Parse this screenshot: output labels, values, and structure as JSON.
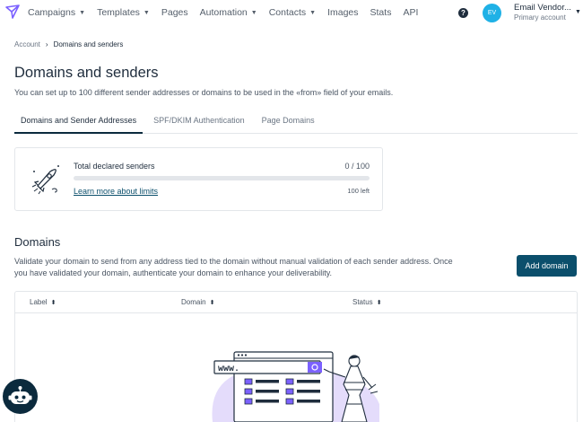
{
  "nav": {
    "items": [
      {
        "label": "Campaigns",
        "dropdown": true
      },
      {
        "label": "Templates",
        "dropdown": true
      },
      {
        "label": "Pages",
        "dropdown": false
      },
      {
        "label": "Automation",
        "dropdown": true
      },
      {
        "label": "Contacts",
        "dropdown": true
      },
      {
        "label": "Images",
        "dropdown": false
      },
      {
        "label": "Stats",
        "dropdown": false
      },
      {
        "label": "API",
        "dropdown": false
      }
    ],
    "help_glyph": "?",
    "avatar_initials": "EV",
    "account_name": "Email Vendor...",
    "account_type": "Primary account"
  },
  "breadcrumb": {
    "root": "Account",
    "current": "Domains and senders"
  },
  "page": {
    "title": "Domains and senders",
    "description": "You can set up to 100 different sender addresses or domains to be used in the «from» field of your emails."
  },
  "tabs": [
    {
      "label": "Domains and Sender Addresses",
      "active": true
    },
    {
      "label": "SPF/DKIM Authentication",
      "active": false
    },
    {
      "label": "Page Domains",
      "active": false
    }
  ],
  "senders_card": {
    "title": "Total declared senders",
    "count": "0 / 100",
    "progress_fraction": 0,
    "link": "Learn more about limits",
    "remaining": "100 left"
  },
  "domains": {
    "title": "Domains",
    "description": "Validate your domain to send from any address tied to the domain without manual validation of each sender address. Once you have validated your domain, authenticate your domain to enhance your deliverability.",
    "add_button": "Add domain"
  },
  "table": {
    "columns": [
      "Label",
      "Domain",
      "Status"
    ]
  },
  "illustration": {
    "url_text": "www."
  },
  "colors": {
    "accent": "#0b4f6c",
    "avatar": "#1fb1e6",
    "logo": "#7b61ff",
    "illustration_blob": "#e4dcfb"
  },
  "icons": {
    "logo": "paper-plane-icon",
    "help": "help-icon",
    "bot": "chatbot-icon",
    "rocket": "rocket-icon"
  }
}
